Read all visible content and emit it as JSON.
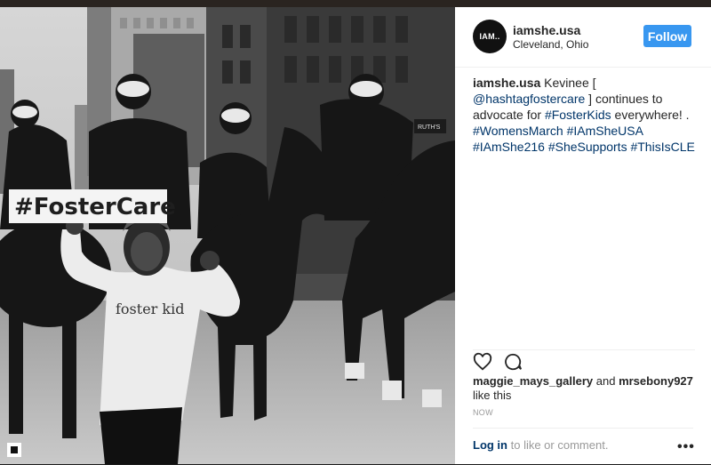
{
  "post": {
    "username": "iamshe.usa",
    "location": "Cleveland, Ohio",
    "avatar_text": "IAM..",
    "follow_label": "Follow",
    "caption": {
      "author": "iamshe.usa",
      "t1": " Kevinee [ ",
      "mention": "@hashtagfostercare",
      "t2": " ] continues to advocate for ",
      "tag1": "#FosterKids",
      "t3": " everywhere! . ",
      "tags": [
        "#WomensMarch",
        "#IAmSheUSA",
        "#IAmShe216",
        "#SheSupports",
        "#ThisIsCLE"
      ]
    },
    "likes": {
      "user1": "maggie_mays_gallery",
      "and": " and ",
      "user2": "mrsebony927",
      "suffix": " like this"
    },
    "time": "NOW",
    "footer": {
      "login_link": "Log in",
      "login_text": " to like or comment.",
      "more": "•••"
    }
  },
  "photo": {
    "sign_text": "#FosterCare",
    "shirt_text": "foster kid",
    "sign_small": "RUTH'S"
  },
  "icons": [
    "heart-icon",
    "comment-icon",
    "more-options-icon",
    "image-badge-icon"
  ],
  "colors": {
    "follow": "#3897f0",
    "link": "#003569"
  }
}
